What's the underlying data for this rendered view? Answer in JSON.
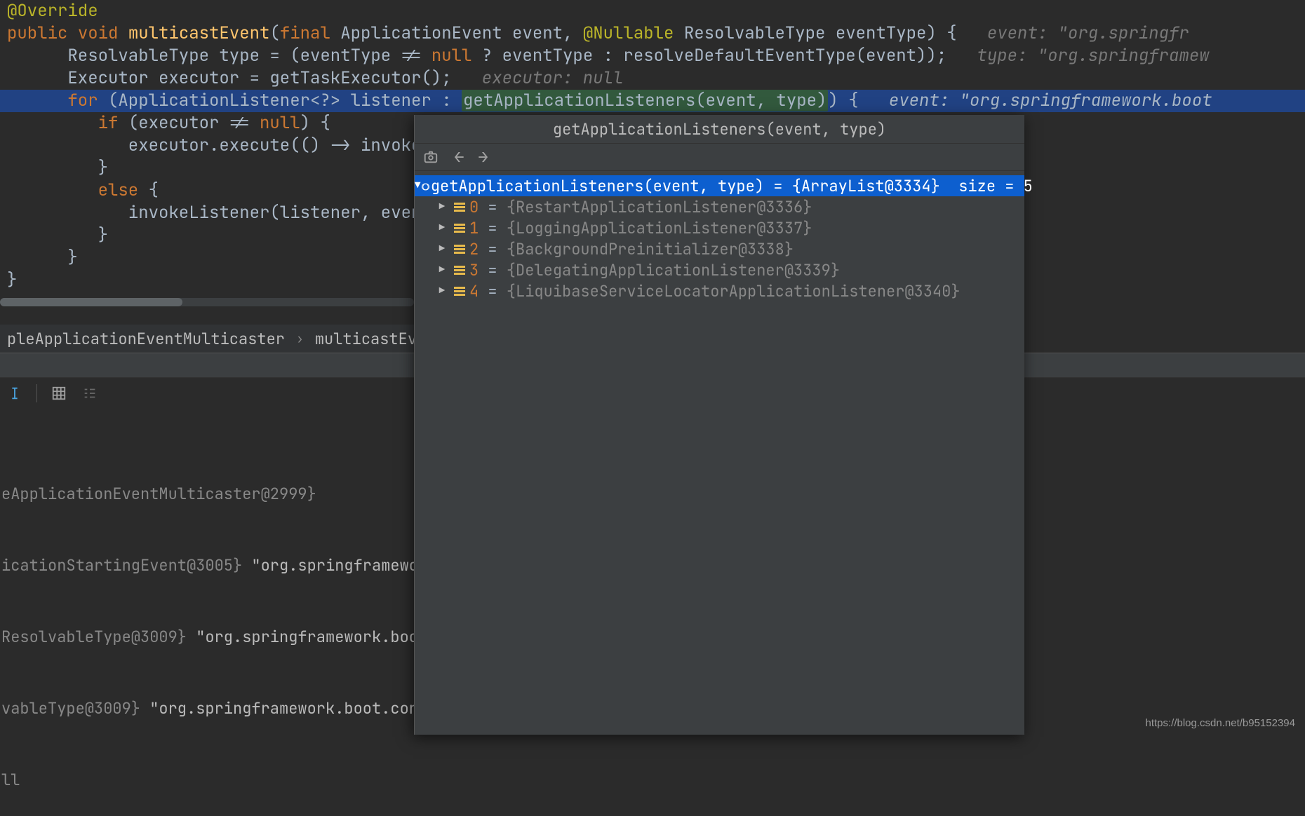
{
  "code": {
    "l1_annotation": "@Override",
    "l2_kw1": "public",
    "l2_kw2": "void",
    "l2_fn": "multicastEvent",
    "l2_plain": "(",
    "l2_kw3": "final",
    "l2_rest": " ApplicationEvent event, ",
    "l2_ann": "@Nullable",
    "l2_rest2": " ResolvableType eventType) {",
    "l2_hint_lbl": "   event: ",
    "l2_hint_val": "\"org.springfr",
    "l3_plain": "      ResolvableType type = (eventType != ",
    "l3_kw": "null",
    "l3_plain2": " ? eventType : resolveDefaultEventType(event));",
    "l3_hint_lbl": "   type: ",
    "l3_hint_val": "\"org.springframew",
    "l4_plain": "      Executor executor = getTaskExecutor();",
    "l4_hint": "   executor: null",
    "l5_indent": "      ",
    "l5_kw": "for",
    "l5_plain": " (ApplicationListener<?> listener : ",
    "l5_call": "getApplicationListeners(event, type)",
    "l5_tail": ") {",
    "l5_hint_lbl": "   event: ",
    "l5_hint_val": "\"org.springframework.boot",
    "l6_indent": "         ",
    "l6_kw": "if",
    "l6_plain": " (executor != ",
    "l6_kw2": "null",
    "l6_tail": ") {",
    "l7": "            executor.execute(() -> invokeListen",
    "l8": "         }",
    "l9_indent": "         ",
    "l9_kw": "else",
    "l9_tail": " {",
    "l10": "            invokeListener(listener, event);",
    "l11": "         }",
    "l12": "      }",
    "l13": "}"
  },
  "breadcrumb": {
    "cls": "pleApplicationEventMulticaster",
    "method": "multicastEvent()"
  },
  "vars": {
    "r1": "eApplicationEventMulticaster@2999}",
    "r2a": "icationStartingEvent@3005} ",
    "r2b": "\"org.springframework.boot.cont",
    "r3a": "ResolvableType@3009} ",
    "r3b": "\"org.springframework.boot.context.e",
    "r4a": "vableType@3009} ",
    "r4b": "\"org.springframework.boot.context.event.A",
    "r5": "ll"
  },
  "popup": {
    "title": "getApplicationListeners(event, type)",
    "root_expr": "getApplicationListeners(event, type)",
    "root_val": "{ArrayList@3334}",
    "root_size": "size = 5",
    "items": [
      {
        "idx": "0",
        "val": "{RestartApplicationListener@3336}"
      },
      {
        "idx": "1",
        "val": "{LoggingApplicationListener@3337}"
      },
      {
        "idx": "2",
        "val": "{BackgroundPreinitializer@3338}"
      },
      {
        "idx": "3",
        "val": "{DelegatingApplicationListener@3339}"
      },
      {
        "idx": "4",
        "val": "{LiquibaseServiceLocatorApplicationListener@3340}"
      }
    ]
  },
  "watermark": "https://blog.csdn.net/b95152394"
}
